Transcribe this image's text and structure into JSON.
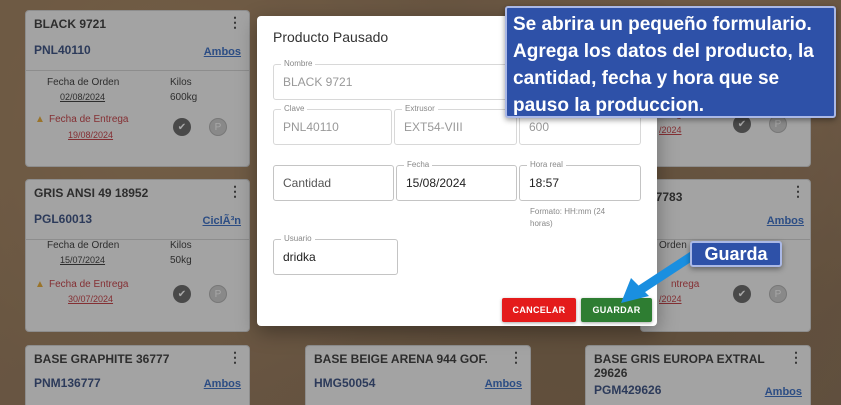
{
  "cards": [
    {
      "title": "BLACK 9721",
      "code": "PNL40110",
      "link": "Ambos",
      "order_label": "Fecha de Orden",
      "order_date": "02/08/2024",
      "kg_label": "Kilos",
      "kg_value": "600kg",
      "delivery_label": "Fecha de Entrega",
      "delivery_date": "19/08/2024"
    },
    {
      "title": "GRIS ANSI 49 18952",
      "code": "PGL60013",
      "link": "CiclÃ³n",
      "order_label": "Fecha de Orden",
      "order_date": "15/07/2024",
      "kg_label": "Kilos",
      "kg_value": "50kg",
      "delivery_label": "Fecha de Entrega",
      "delivery_date": "30/07/2024"
    },
    {
      "title": "BASE GRAPHITE 36777",
      "code": "PNM136777",
      "link": "Ambos"
    },
    {
      "title": "BASE BEIGE ARENA 944 GOF.",
      "code": "HMG50054",
      "link": "Ambos"
    },
    {
      "title": "BASE GRIS EUROPA EXTRAL",
      "title2": "29626",
      "code": "PGM429626",
      "link": "Ambos"
    }
  ],
  "right_partial": {
    "top": {
      "fragment": "ntrega",
      "date": "/2024"
    },
    "mid": {
      "code_frag": "77783",
      "code2_frag": "3",
      "link": "Ambos",
      "order_frag": "Orden",
      "delivery_frag": "ntrega",
      "date": "/2024"
    }
  },
  "modal": {
    "title": "Producto Pausado",
    "fields": {
      "nombre": {
        "label": "Nombre",
        "value": "BLACK 9721"
      },
      "clave": {
        "label": "Clave",
        "value": "PNL40110"
      },
      "extrusor": {
        "label": "Extrusor",
        "value": "EXT54-VIII"
      },
      "third": {
        "value": "600"
      },
      "cantidad": {
        "placeholder": "Cantidad"
      },
      "fecha": {
        "label": "Fecha",
        "value": "15/08/2024"
      },
      "hora": {
        "label": "Hora real",
        "value": "18:57",
        "helper": "Formato: HH:mm (24 horas)"
      },
      "usuario": {
        "label": "Usuario",
        "value": "dridka"
      }
    },
    "cancel_label": "CANCELAR",
    "save_label": "GUARDAR"
  },
  "annotations": {
    "callout_main": "Se abrira un pequeño formulario. Agrega los datos del producto, la cantidad, fecha y hora que se pauso la produccion.",
    "callout_save": "Guarda"
  },
  "colors": {
    "accent_blue": "#2e51a8",
    "cancel": "#e41b1b",
    "save": "#2e7d32",
    "link": "#1f5bbf",
    "red_date": "#c0262d"
  },
  "icons": [
    "kebab-menu-icon",
    "warning-icon",
    "check-circle-icon",
    "pause-circle-icon",
    "arrow-icon"
  ]
}
